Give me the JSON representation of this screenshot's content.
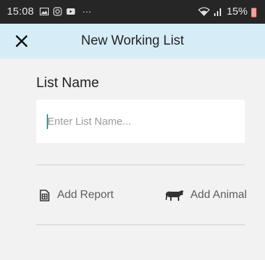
{
  "status_bar": {
    "time": "15:08",
    "extra": "···",
    "battery_percent": "15%"
  },
  "header": {
    "title": "New Working List",
    "close_icon": "close-icon"
  },
  "form": {
    "list_name_label": "List Name",
    "list_name_placeholder": "Enter List Name...",
    "list_name_value": ""
  },
  "actions": {
    "add_report_label": "Add Report",
    "add_report_icon": "report-icon",
    "add_animal_label": "Add Animal",
    "add_animal_icon": "cow-icon"
  },
  "colors": {
    "header_bg": "#d6edf8",
    "page_bg": "#f2f2f2",
    "cursor": "#22a897"
  }
}
